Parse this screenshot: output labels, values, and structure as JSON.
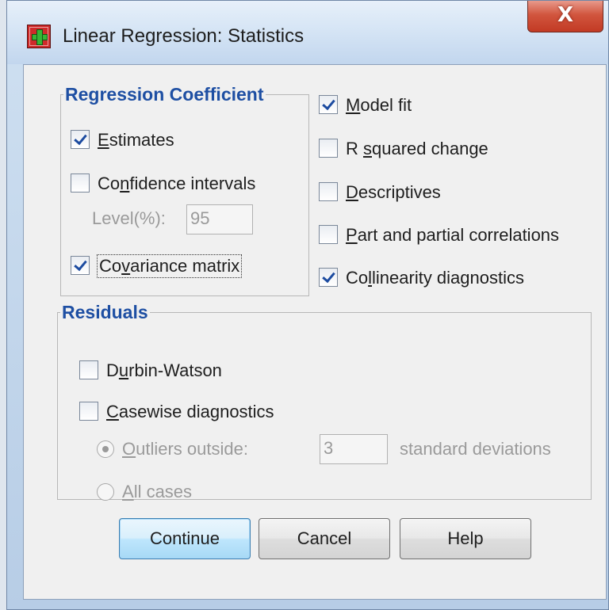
{
  "window": {
    "title": "Linear Regression: Statistics",
    "close_glyph": "X",
    "icon": "spss-add-icon"
  },
  "regression_coefficients": {
    "title": "Regression Coefficient",
    "estimates": {
      "pre": "",
      "mnemonic": "E",
      "post": "stimates",
      "checked": true
    },
    "confidence_intervals": {
      "pre": "Co",
      "mnemonic": "n",
      "post": "fidence intervals",
      "checked": false
    },
    "level_label": "Level(%):",
    "level_value": "95",
    "covariance_matrix": {
      "pre": "Co",
      "mnemonic": "v",
      "post": "ariance matrix",
      "checked": true
    }
  },
  "options": {
    "model_fit": {
      "pre": "",
      "mnemonic": "M",
      "post": "odel fit",
      "checked": true
    },
    "r_squared_change": {
      "pre": "R ",
      "mnemonic": "s",
      "post": "quared change",
      "checked": false
    },
    "descriptives": {
      "pre": "",
      "mnemonic": "D",
      "post": "escriptives",
      "checked": false
    },
    "part_partial": {
      "pre": "",
      "mnemonic": "P",
      "post": "art and partial correlations",
      "checked": false
    },
    "collinearity": {
      "pre": "Co",
      "mnemonic": "l",
      "post": "linearity diagnostics",
      "checked": true
    }
  },
  "residuals": {
    "title": "Residuals",
    "durbin_watson": {
      "pre": "D",
      "mnemonic": "u",
      "post": "rbin-Watson",
      "checked": false
    },
    "casewise": {
      "pre": "",
      "mnemonic": "C",
      "post": "asewise diagnostics",
      "checked": false
    },
    "outliers": {
      "pre": "",
      "mnemonic": "O",
      "post": "utliers outside:",
      "selected": true
    },
    "outliers_value": "3",
    "std_dev_label": "standard deviations",
    "all_cases": {
      "pre": "",
      "mnemonic": "A",
      "post": "ll cases",
      "selected": false
    }
  },
  "buttons": {
    "continue": "Continue",
    "cancel": "Cancel",
    "help": "Help"
  }
}
